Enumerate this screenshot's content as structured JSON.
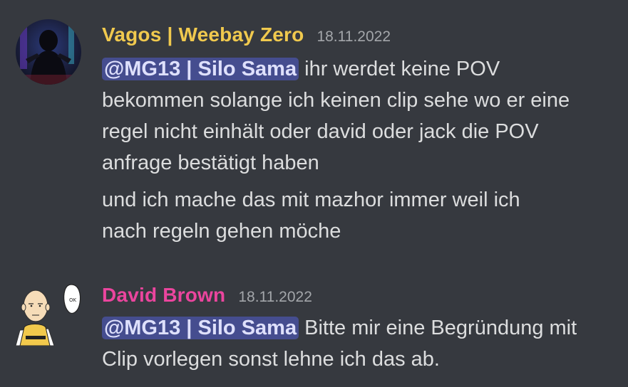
{
  "colors": {
    "background": "#36393f",
    "text": "#dcddde",
    "timestamp": "#a3a6aa",
    "mention_bg": "#5865f2",
    "mention_text": "#dee0fc"
  },
  "messages": [
    {
      "author": "Vagos | Weebay Zero",
      "author_color": "#f0c94e",
      "timestamp": "18.11.2022",
      "avatar_icon": "hooded-figure-avatar",
      "mention": "@MG13 | Silo Sama",
      "lines": [
        " ihr werdet keine POV",
        "bekommen solange ich keinen clip sehe wo er eine",
        "regel nicht einhält oder david oder jack die POV",
        "anfrage bestätigt haben"
      ],
      "paragraph2": [
        "und ich mache das mit mazhor immer weil ich",
        "nach regeln gehen möche"
      ]
    },
    {
      "author": "David Brown",
      "author_color": "#eb459e",
      "timestamp": "18.11.2022",
      "avatar_icon": "saitama-ok-avatar",
      "avatar_bubble_text": "OK",
      "mention": "@MG13 | Silo Sama",
      "lines": [
        " Bitte mir eine Begründung mit",
        "Clip vorlegen sonst lehne ich das ab."
      ]
    }
  ]
}
